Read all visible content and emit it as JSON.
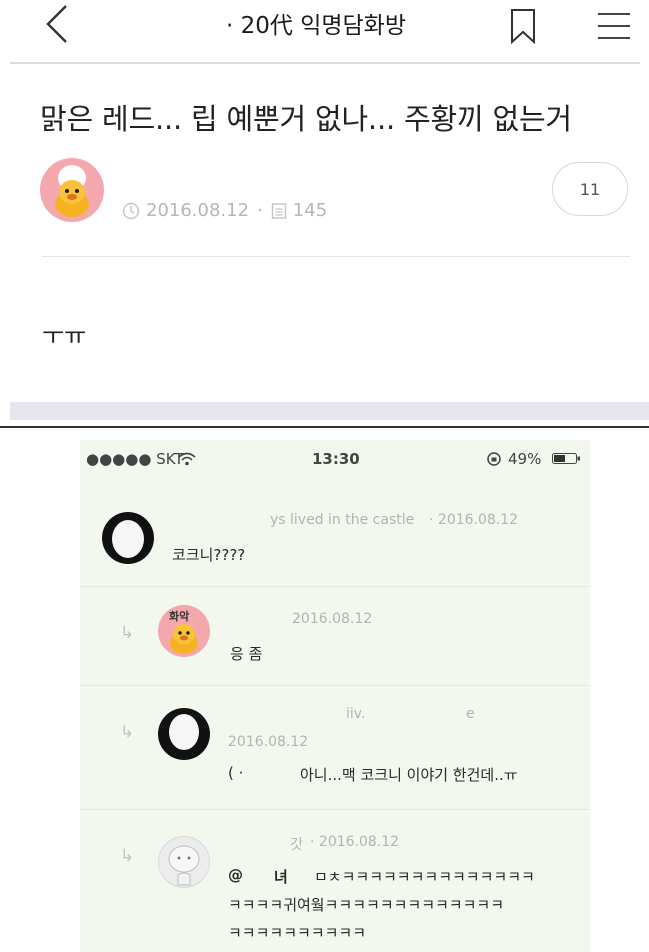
{
  "header": {
    "room_title": "· 20代 익명담화방",
    "icons": {
      "back": "back-chevron-icon",
      "bookmark": "bookmark-icon",
      "menu": "hamburger-menu-icon"
    }
  },
  "post": {
    "title": "맑은 레드... 립 예뿐거 없나... 주황끼 없는거",
    "date": "2016.08.12",
    "views": "145",
    "comment_count": "11",
    "body": "ㅜㅠ"
  },
  "status_bar": {
    "carrier": "●●●●● SKT",
    "time": "13:30",
    "battery": "49%"
  },
  "comments": [
    {
      "author": "ys lived in the castle",
      "date": "2016.08.12",
      "text": "코크니????"
    },
    {
      "author": "화악",
      "date": "2016.08.12",
      "text": "응 좀"
    },
    {
      "author": "iiv.",
      "author_extra": "e",
      "date": "2016.08.12",
      "text": "아니...맥 코크니 이야기 한건데..ㅠ",
      "prefix": "( ·"
    },
    {
      "author": "갓",
      "date": "2016.08.12",
      "line1_prefix": "@",
      "line1_name": "녀",
      "line1_text": "ㅁㅊㅋㅋㅋㅋㅋㅋㅋㅋㅋㅋㅋㅋㅋㅋ",
      "line2": "ㅋㅋㅋㅋ귀여웤ㅋㅋㅋㅋㅋㅋㅋㅋㅋㅋㅋㅋㅋ",
      "line3": "ㅋㅋㅋㅋㅋㅋㅋㅋㅋㅋ"
    }
  ],
  "colors": {
    "meta_gray": "#b6b6b6",
    "phone_bg": "#f3f8ef",
    "avatar_pink": "#f4a8ae"
  }
}
